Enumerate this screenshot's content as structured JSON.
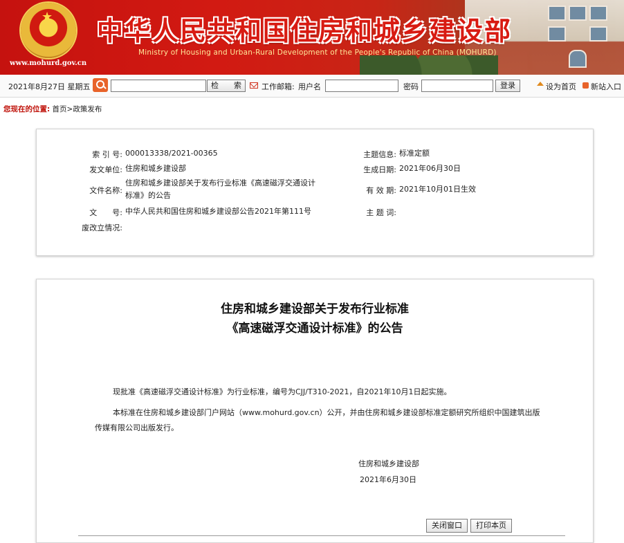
{
  "header": {
    "site_url": "www.mohurd.gov.cn",
    "title_cn": "中华人民共和国住房和城乡建设部",
    "title_en": "Ministry of Housing and Urban-Rural Development of the People's Republic of China (MOHURD)"
  },
  "toolbar": {
    "date": "2021年8月27日 星期五",
    "search_value": "",
    "search_button": "检　　索",
    "mail_label": "工作邮箱:",
    "username_label": "用户名",
    "username_value": "",
    "password_label": "密码",
    "password_value": "",
    "login_button": "登录",
    "set_home": "设为首页",
    "new_site": "新站入口"
  },
  "breadcrumb": {
    "label": "您现在的位置:",
    "path": "首页>政策发布"
  },
  "info": {
    "index_label": "索 引 号:",
    "index_value": "000013338/2021-00365",
    "issuer_label": "发文单位:",
    "issuer_value": "住房和城乡建设部",
    "filename_label": "文件名称:",
    "filename_value_1": "住房和城乡建设部关于发布行业标准《高速磁浮交通设计",
    "filename_value_2": "标准》的公告",
    "docno_label": "文　　号:",
    "docno_value": "中华人民共和国住房和城乡建设部公告2021年第111号",
    "status_label": "废改立情况:",
    "status_value": "",
    "topic_label": "主题信息:",
    "topic_value": "标准定额",
    "created_label": "生成日期:",
    "created_value": "2021年06月30日",
    "validity_label": "有 效 期:",
    "validity_value": "2021年10月01日生效",
    "keywords_label": "主 题 词:",
    "keywords_value": ""
  },
  "article": {
    "title_line1": "住房和城乡建设部关于发布行业标准",
    "title_line2": "《高速磁浮交通设计标准》的公告",
    "para1": "现批准《高速磁浮交通设计标准》为行业标准，编号为CJJ/T310-2021，自2021年10月1日起实施。",
    "para2_line1": "本标准在住房和城乡建设部门户网站（www.mohurd.gov.cn）公开，并由住房和城乡建设部标准定额研究所组织中国建筑出版",
    "para2_line2": "传媒有限公司出版发行。",
    "signer": "住房和城乡建设部",
    "sign_date": "2021年6月30日",
    "close_button": "关闭窗口",
    "print_button": "打印本页"
  }
}
